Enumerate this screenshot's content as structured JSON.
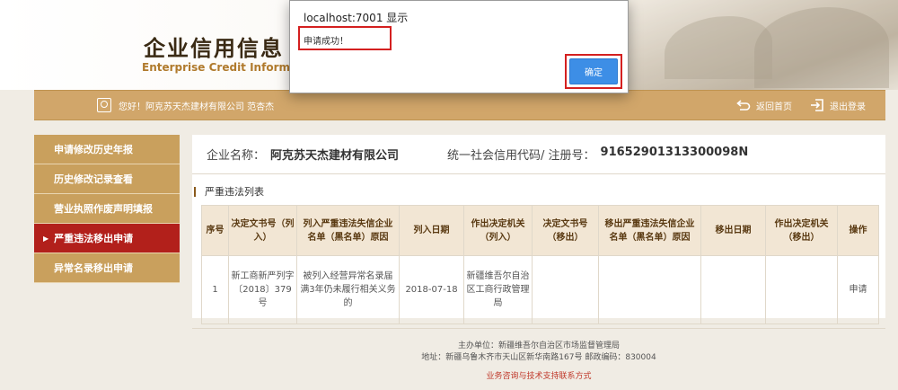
{
  "header": {
    "logo_cn": "企业信用信息",
    "logo_en": "Enterprise Credit Information"
  },
  "nav": {
    "greeting": "您好！阿克苏天杰建材有限公司  范杏杰",
    "home_label": "返回首页",
    "logout_label": "退出登录"
  },
  "sidebar": {
    "items": [
      {
        "label": "申请修改历史年报"
      },
      {
        "label": "历史修改记录查看"
      },
      {
        "label": "营业执照作废声明填报"
      },
      {
        "label": "严重违法移出申请",
        "active": true
      },
      {
        "label": "异常名录移出申请"
      }
    ],
    "active_arrow": "▶"
  },
  "company": {
    "name_label": "企业名称：",
    "name_value": "阿克苏天杰建材有限公司",
    "code_label": "统一社会信用代码/ 注册号：",
    "code_value": "91652901313300098N"
  },
  "section": {
    "title": "严重违法列表"
  },
  "table": {
    "headers": [
      "序号",
      "决定文书号（列入）",
      "列入严重违法失信企业名单（黑名单）原因",
      "列入日期",
      "作出决定机关（列入）",
      "决定文书号（移出）",
      "移出严重违法失信企业名单（黑名单）原因",
      "移出日期",
      "作出决定机关（移出）",
      "操作"
    ],
    "rows": [
      {
        "index": "1",
        "doc_in": "新工商新严列字〔2018〕379号",
        "reason_in": "被列入经营异常名录届满3年仍未履行相关义务的",
        "date_in": "2018-07-18",
        "org_in": "新疆维吾尔自治区工商行政管理局",
        "doc_out": "",
        "reason_out": "",
        "date_out": "",
        "org_out": "",
        "action": "申请"
      }
    ]
  },
  "footer": {
    "sponsor": "主办单位：新疆维吾尔自治区市场监督管理局",
    "address": "地址：新疆乌鲁木齐市天山区新华南路167号   邮政编码：830004",
    "contact": "业务咨询与技术支持联系方式"
  },
  "dialog": {
    "host": "localhost:7001 显示",
    "message": "申请成功！",
    "ok_label": "确定"
  },
  "colors": {
    "nav_bar": "#d1a66a",
    "sidebar_item": "#c9a05d",
    "sidebar_active": "#b2201b",
    "table_header": "#f2e6d4",
    "dialog_button": "#3d8ee6",
    "highlight_box": "#d42020"
  },
  "icons": {
    "user": "user-card-icon",
    "home": "return-arrow-icon",
    "logout": "logout-icon"
  }
}
